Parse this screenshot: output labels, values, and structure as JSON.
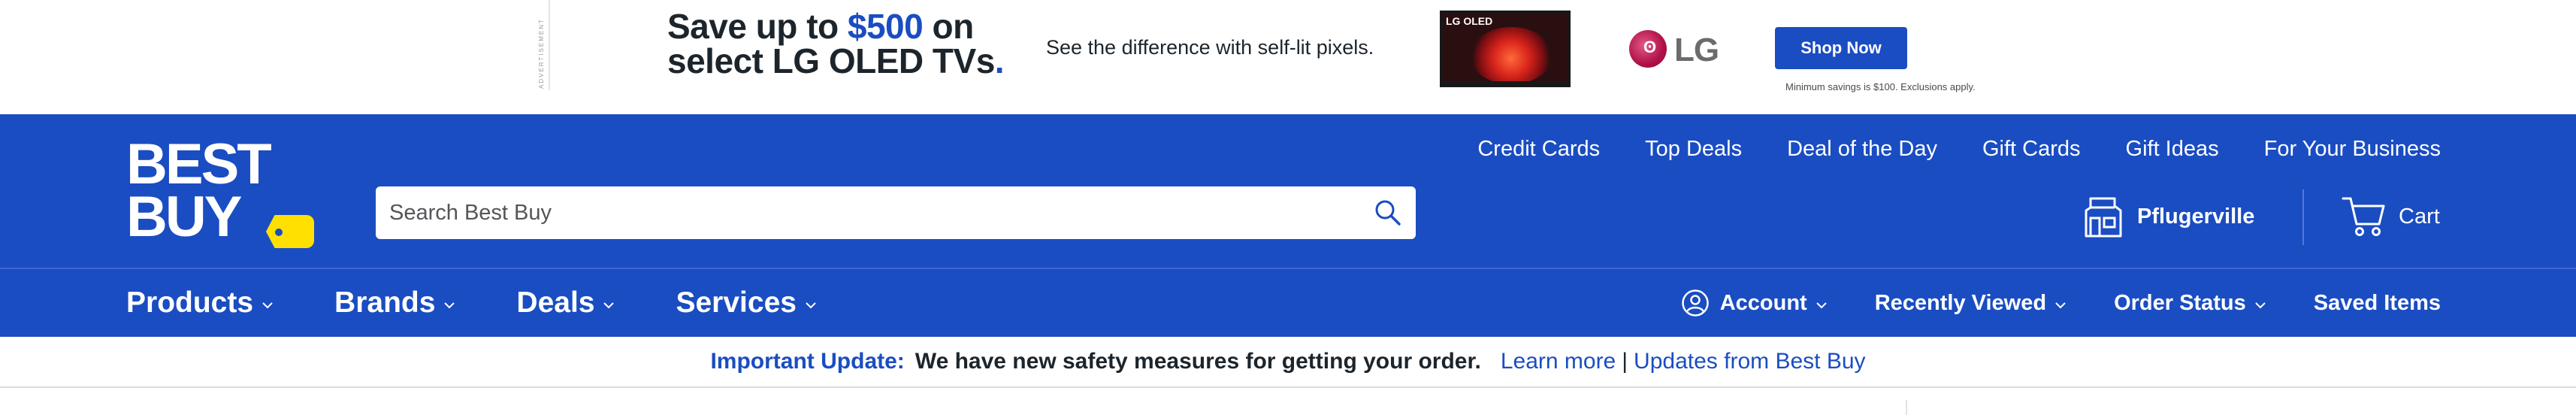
{
  "ad": {
    "tag": "ADVERTISEMENT",
    "headline_line1_prefix": "Save up to ",
    "headline_amount": "$500",
    "headline_line1_suffix": " on",
    "headline_line2": "select LG OLED TVs",
    "headline_dot": ".",
    "subtext": "See the difference with self-lit pixels.",
    "tv_label": "LG OLED",
    "brand": "LG",
    "cta_label": "Shop Now",
    "disclaimer": "Minimum savings is $100. Exclusions apply."
  },
  "header": {
    "logo_line1": "BEST",
    "logo_line2": "BUY",
    "utility_links": [
      "Credit Cards",
      "Top Deals",
      "Deal of the Day",
      "Gift Cards",
      "Gift Ideas",
      "For Your Business"
    ],
    "search_placeholder": "Search Best Buy",
    "store_name": "Pflugerville",
    "cart_label": "Cart"
  },
  "nav": {
    "left": [
      "Products",
      "Brands",
      "Deals",
      "Services"
    ],
    "account_label": "Account",
    "recently_viewed_label": "Recently Viewed",
    "order_status_label": "Order Status",
    "saved_items_label": "Saved Items"
  },
  "update": {
    "title": "Important Update:",
    "message": "We have new safety measures for getting your order.",
    "learn_more": "Learn more",
    "separator": "|",
    "updates_link": "Updates from Best Buy"
  },
  "colors": {
    "brand_blue": "#1a4dc2",
    "brand_yellow": "#ffe000",
    "lg_magenta": "#b01049"
  }
}
